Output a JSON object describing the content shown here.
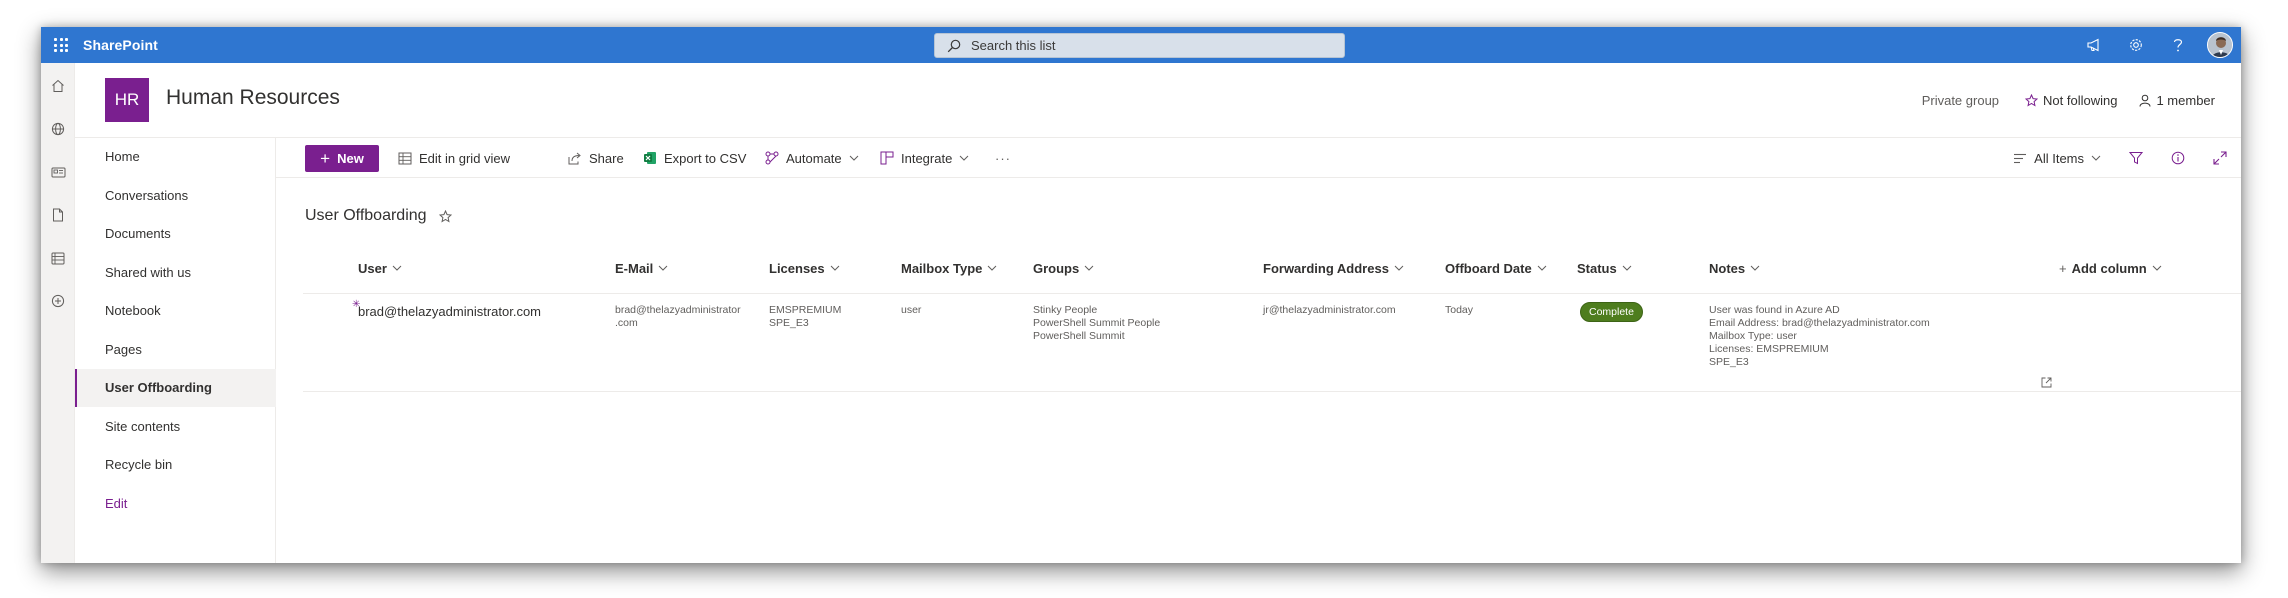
{
  "suite": {
    "app_name": "SharePoint",
    "search_placeholder": "Search this list",
    "icons": [
      "megaphone-icon",
      "gear-icon",
      "help-icon",
      "avatar"
    ]
  },
  "appbar": {
    "icons": [
      "home-icon",
      "globe-icon",
      "news-icon",
      "document-icon",
      "list-icon",
      "create-icon"
    ]
  },
  "site": {
    "logo_initials": "HR",
    "title": "Human Resources",
    "privacy": "Private group",
    "follow_label": "Not following",
    "members_label": "1 member"
  },
  "nav": {
    "items": [
      {
        "label": "Home"
      },
      {
        "label": "Conversations"
      },
      {
        "label": "Documents"
      },
      {
        "label": "Shared with us"
      },
      {
        "label": "Notebook"
      },
      {
        "label": "Pages"
      },
      {
        "label": "User Offboarding",
        "selected": true
      },
      {
        "label": "Site contents"
      },
      {
        "label": "Recycle bin"
      }
    ],
    "edit_label": "Edit"
  },
  "commands": {
    "new": "New",
    "grid": "Edit in grid view",
    "share": "Share",
    "export": "Export to CSV",
    "automate": "Automate",
    "integrate": "Integrate",
    "more": "···",
    "view": "All Items"
  },
  "list": {
    "title": "User Offboarding",
    "columns": [
      "User",
      "E-Mail",
      "Licenses",
      "Mailbox Type",
      "Groups",
      "Forwarding Address",
      "Offboard Date",
      "Status",
      "Notes",
      "Add column"
    ],
    "rows": [
      {
        "user": "brad@thelazyadministrator.com",
        "email_line1": "brad@thelazyadministrator",
        "email_line2": ".com",
        "licenses_line1": "EMSPREMIUM",
        "licenses_line2": "SPE_E3",
        "mailbox_type": "user",
        "groups": [
          "Stinky People",
          "PowerShell Summit People",
          "PowerShell Summit"
        ],
        "forwarding_address": "jr@thelazyadministrator.com",
        "offboard_date": "Today",
        "status": "Complete",
        "notes": [
          "User was found in Azure AD",
          "Email Address: brad@thelazyadministrator.com",
          "Mailbox Type: user",
          "Licenses: EMSPREMIUM",
          "SPE_E3"
        ]
      }
    ]
  },
  "colors": {
    "suite_bar": "#2f76d0",
    "theme": "#7a1f8f",
    "status_complete": "#4e7d1e"
  }
}
